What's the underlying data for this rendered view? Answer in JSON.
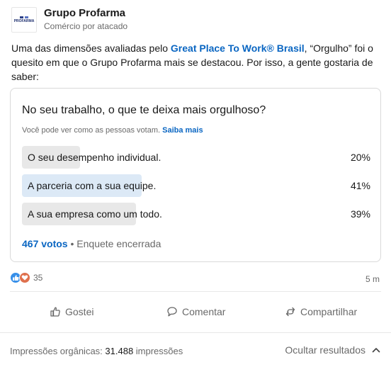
{
  "author": {
    "logo_text": "PROFARMA",
    "name": "Grupo Profarma",
    "subtitle": "Comércio por atacado"
  },
  "post": {
    "text_before": "Uma das dimensões avaliadas pelo ",
    "link_text": "Great Place To Work® Brasil",
    "text_after": ", “Orgulho” foi o quesito em que o Grupo Profarma mais se destacou. Por isso, a gente gostaria de saber:"
  },
  "poll": {
    "question": "No seu trabalho, o que te deixa mais orgulhoso?",
    "visibility_note": "Você pode ver como as pessoas votam.",
    "learn_more": "Saiba mais",
    "options": [
      {
        "label": "O seu desempenho individual.",
        "percent": "20%",
        "fraction": 0.2
      },
      {
        "label": "A parceria com a sua equipe.",
        "percent": "41%",
        "fraction": 0.41
      },
      {
        "label": "A sua empresa como um todo.",
        "percent": "39%",
        "fraction": 0.39
      }
    ],
    "votes": "467 votos",
    "separator": " • ",
    "status": "Enquete encerrada"
  },
  "social": {
    "reaction_count": "35",
    "timestamp": "5 m",
    "reaction_icons": [
      "like-icon",
      "love-icon"
    ]
  },
  "actions": {
    "like": "Gostei",
    "comment": "Comentar",
    "share": "Compartilhar"
  },
  "analytics": {
    "label": "Impressões orgânicas: ",
    "count": "31.488",
    "suffix": " impressões",
    "hide_results": "Ocultar resultados"
  },
  "colors": {
    "link": "#0a66c2",
    "bar_default": "#e8e8e8",
    "bar_top": "#dce9f6",
    "like": "#378fe9",
    "love": "#df704d"
  }
}
